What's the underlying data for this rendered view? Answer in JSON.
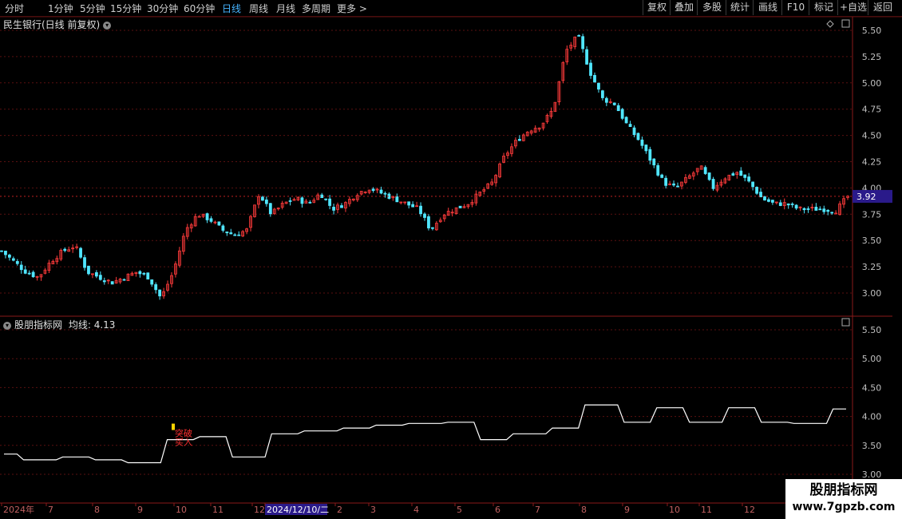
{
  "toolbar": {
    "tabs": [
      "分时",
      "1分钟",
      "5分钟",
      "15分钟",
      "30分钟",
      "60分钟",
      "日线",
      "周线",
      "月线",
      "多周期",
      "更多 >"
    ],
    "active_tab": "日线",
    "buttons": [
      "复权",
      "叠加",
      "多股",
      "统计",
      "画线",
      "F10",
      "标记",
      "+自选",
      "返回"
    ]
  },
  "main_chart": {
    "title": "民生银行(日线 前复权)",
    "current_price_label": "3.92",
    "y_ticks": [
      "5.50",
      "5.25",
      "5.00",
      "4.75",
      "4.50",
      "4.25",
      "4.00",
      "3.75",
      "3.50",
      "3.25",
      "3.00"
    ]
  },
  "indicator": {
    "title": "股朋指标网 均线: 4.13",
    "name": "股朋指标网",
    "label": "均线: 4.13",
    "y_ticks": [
      "5.50",
      "5.00",
      "4.50",
      "4.00",
      "3.50",
      "3.00"
    ],
    "signal_text": "突破",
    "signal_text2": "买入"
  },
  "x_axis": {
    "labels": [
      "2024年",
      "7",
      "8",
      "9",
      "10",
      "11",
      "12",
      "2024/12/10/二",
      "2",
      "3",
      "4",
      "5",
      "6",
      "7",
      "8",
      "9",
      "10",
      "11",
      "12"
    ],
    "highlight": "2024/12/10/二"
  },
  "watermark": {
    "line1": "股朋指标网",
    "line2": "www.7gpzb.com"
  },
  "colors": {
    "up": "#ff3b3b",
    "down": "#50e6ff",
    "grid": "#5a1010",
    "price_tag": "#2a1a8a",
    "indicator_line": "#ffffff"
  },
  "chart_data": {
    "type": "candlestick",
    "title": "民生银行(日线 前复权)",
    "ylim": [
      2.9,
      5.55
    ],
    "closes_sampled": [
      3.4,
      3.3,
      3.2,
      3.15,
      3.3,
      3.4,
      3.45,
      3.2,
      3.15,
      3.1,
      3.15,
      3.2,
      3.15,
      2.95,
      3.2,
      3.6,
      3.75,
      3.7,
      3.6,
      3.55,
      3.6,
      3.95,
      3.75,
      3.85,
      3.9,
      3.85,
      3.95,
      3.8,
      3.85,
      3.95,
      4.0,
      3.95,
      3.9,
      3.85,
      3.8,
      3.6,
      3.75,
      3.8,
      3.85,
      3.95,
      4.05,
      4.3,
      4.45,
      4.55,
      4.6,
      4.75,
      5.3,
      5.45,
      5.1,
      4.85,
      4.8,
      4.6,
      4.45,
      4.25,
      4.05,
      4.0,
      4.1,
      4.2,
      4.0,
      4.1,
      4.15,
      4.05,
      3.9,
      3.85,
      3.85,
      3.8,
      3.8,
      3.8,
      3.78,
      3.92
    ],
    "indicator_line_sampled": [
      3.35,
      3.25,
      3.3,
      3.25,
      3.2,
      3.6,
      3.65,
      3.3,
      3.7,
      3.75,
      3.8,
      3.85,
      3.88,
      3.9,
      3.6,
      3.7,
      3.8,
      4.2,
      3.9,
      4.15,
      3.9,
      4.15,
      3.9,
      3.88,
      4.13
    ]
  }
}
